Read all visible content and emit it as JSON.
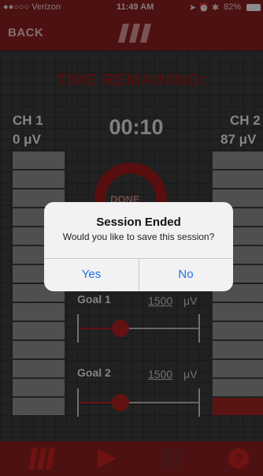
{
  "status": {
    "carrier": "●●○○○ Verizon",
    "time": "11:49 AM",
    "battery": "82%"
  },
  "nav": {
    "back_label": "BACK"
  },
  "session": {
    "time_remaining_label": "TIME REMAINING:",
    "timer": "00:10",
    "done_label": "DONE",
    "ch1": {
      "label": "CH 1",
      "value": "0 μV"
    },
    "ch2": {
      "label": "CH 2",
      "value": "87 μV"
    }
  },
  "goals": [
    {
      "label": "Goal 1",
      "value": "1500",
      "unit": "μV",
      "level": 0.35
    },
    {
      "label": "Goal 2",
      "value": "1500",
      "unit": "μV",
      "level": 0.35
    }
  ],
  "dialog": {
    "title": "Session Ended",
    "message": "Would you like to save this session?",
    "yes_label": "Yes",
    "no_label": "No"
  },
  "colors": {
    "accent": "#b32222",
    "nav": "#8e1f1f",
    "link": "#1a73e8"
  },
  "icons": {
    "tab1": "logo-icon",
    "tab2": "play-icon",
    "tab3": "pause-icon",
    "tab4": "help-icon"
  }
}
